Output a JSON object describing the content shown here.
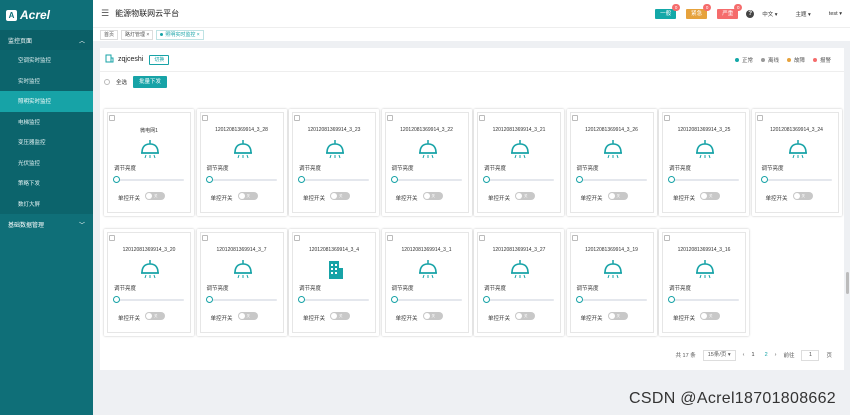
{
  "brand": {
    "logo_text": "Acrel",
    "logo_mark": "A"
  },
  "sidebar": {
    "group1": "监控页面",
    "items": [
      {
        "label": "空调实时监控",
        "active": false
      },
      {
        "label": "实时监控",
        "active": false
      },
      {
        "label": "照明实时监控",
        "active": true
      },
      {
        "label": "电梯监控",
        "active": false
      },
      {
        "label": "变压器监控",
        "active": false
      },
      {
        "label": "光伏监控",
        "active": false
      },
      {
        "label": "策略下发",
        "active": false
      },
      {
        "label": "数灯大屏",
        "active": false
      }
    ],
    "group2": "基础数据管理"
  },
  "header": {
    "title": "能源物联网云平台",
    "alarms": [
      {
        "label": "一般",
        "count": "0",
        "color": "#13a8a8"
      },
      {
        "label": "紧急",
        "count": "0",
        "color": "#e6a23c"
      },
      {
        "label": "严重",
        "count": "0",
        "color": "#f56c6c"
      }
    ],
    "lang": "中文",
    "theme": "主题",
    "user": "test",
    "help": "?"
  },
  "tags": {
    "home": "首页",
    "policy": "路灯管理",
    "current": "照明实时监控"
  },
  "site": {
    "name": "zqjceshi",
    "switch_label": "切换"
  },
  "legend": [
    {
      "label": "正常",
      "color": "#13a8a8"
    },
    {
      "label": "离线",
      "color": "#999999"
    },
    {
      "label": "故障",
      "color": "#e6a23c"
    },
    {
      "label": "报警",
      "color": "#f56c6c"
    }
  ],
  "actions": {
    "select_all": "全选",
    "batch_label": "批量下发"
  },
  "card_labels": {
    "brightness": "调节亮度",
    "switch": "单控开关",
    "toggle_off": "关"
  },
  "cards": [
    {
      "name": "微电网1",
      "icon": "lamp-icon"
    },
    {
      "name": "12012081369914_3_28",
      "icon": "lamp-icon"
    },
    {
      "name": "12012081369914_3_23",
      "icon": "lamp-icon"
    },
    {
      "name": "12012081369914_3_22",
      "icon": "lamp-icon"
    },
    {
      "name": "12012081369914_3_21",
      "icon": "lamp-icon"
    },
    {
      "name": "12012081369914_3_26",
      "icon": "lamp-icon"
    },
    {
      "name": "12012081369914_3_25",
      "icon": "lamp-icon"
    },
    {
      "name": "12012081369914_3_24",
      "icon": "lamp-icon"
    },
    {
      "name": "12012081369914_3_20",
      "icon": "lamp-icon"
    },
    {
      "name": "12012081369914_3_7",
      "icon": "lamp-icon"
    },
    {
      "name": "12012081369914_3_4",
      "icon": "building-icon"
    },
    {
      "name": "12012081369914_3_1",
      "icon": "lamp-icon"
    },
    {
      "name": "12012081369914_3_27",
      "icon": "lamp-icon"
    },
    {
      "name": "12012081369914_3_19",
      "icon": "lamp-icon"
    },
    {
      "name": "12012081369914_3_16",
      "icon": "lamp-icon"
    }
  ],
  "pager": {
    "total": "共 17 条",
    "page_size": "15条/页",
    "prev": "‹",
    "pages": [
      "1",
      "2"
    ],
    "current_page": "2",
    "next": "›",
    "goto": "前往",
    "goto_value": "1",
    "page_unit": "页"
  },
  "watermark": "CSDN @Acrel18701808662"
}
